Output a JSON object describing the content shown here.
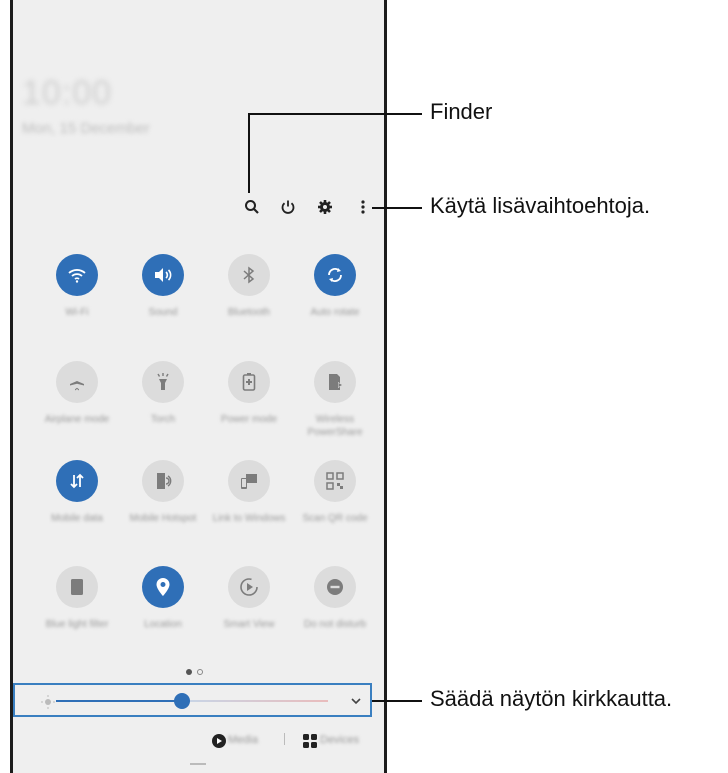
{
  "panel": {
    "clock": "10:00",
    "date": "Mon, 15 December",
    "tiles": [
      {
        "label": "Wi-Fi",
        "state": "on",
        "icon": "wifi-icon"
      },
      {
        "label": "Sound",
        "state": "on",
        "icon": "volume-icon"
      },
      {
        "label": "Bluetooth",
        "state": "off",
        "icon": "bluetooth-icon"
      },
      {
        "label": "Auto rotate",
        "state": "on",
        "icon": "rotate-icon"
      },
      {
        "label": "Airplane mode",
        "state": "off",
        "icon": "airplane-icon"
      },
      {
        "label": "Torch",
        "state": "off",
        "icon": "flashlight-icon"
      },
      {
        "label": "Power mode",
        "state": "off",
        "icon": "battery-icon"
      },
      {
        "label": "Wireless PowerShare",
        "state": "off",
        "icon": "powershare-icon"
      },
      {
        "label": "Mobile data",
        "state": "on",
        "icon": "data-arrows-icon"
      },
      {
        "label": "Mobile Hotspot",
        "state": "off",
        "icon": "hotspot-icon"
      },
      {
        "label": "Link to Windows",
        "state": "off",
        "icon": "link-windows-icon"
      },
      {
        "label": "Scan QR code",
        "state": "off",
        "icon": "qr-icon"
      },
      {
        "label": "Blue light filter",
        "state": "off",
        "icon": "bluelight-icon"
      },
      {
        "label": "Location",
        "state": "on",
        "icon": "location-icon"
      },
      {
        "label": "Smart View",
        "state": "off",
        "icon": "smartview-icon"
      },
      {
        "label": "Do not disturb",
        "state": "off",
        "icon": "dnd-icon"
      }
    ],
    "brightness_level": 0.43,
    "bottom": {
      "media_label": "Media",
      "devices_label": "Devices"
    }
  },
  "callouts": {
    "finder": "Finder",
    "more_options": "Käytä lisävaihtoehtoja.",
    "brightness": "Säädä näytön kirkkautta."
  },
  "colors": {
    "accent": "#2f6fb7",
    "tile_off": "#dcdcdc",
    "panel_bg": "#efefef",
    "highlight_border": "#3a7fc0"
  }
}
